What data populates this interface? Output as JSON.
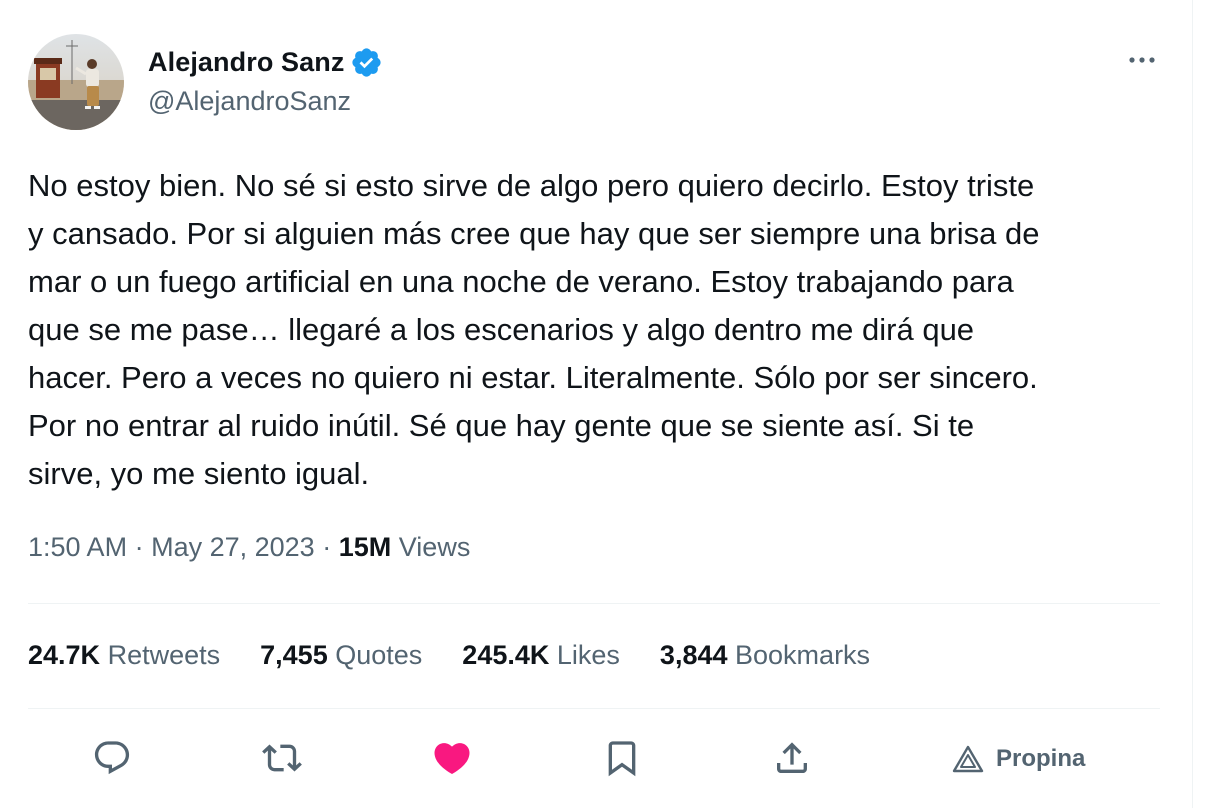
{
  "author": {
    "display_name": "Alejandro Sanz",
    "handle": "@AlejandroSanz",
    "verified": true
  },
  "tweet": {
    "text_lines": [
      "No estoy bien. No sé si esto sirve de algo pero quiero decirlo. Estoy triste",
      "y cansado. Por si alguien más cree que hay que ser siempre una brisa de",
      "mar o un fuego artificial en una noche de verano. Estoy trabajando para",
      "que se me pase… llegaré a los escenarios y algo dentro me dirá que",
      "hacer. Pero a veces no quiero ni estar. Literalmente. Sólo por ser sincero.",
      "Por no entrar al ruido inútil. Sé que hay gente que se siente así. Si te",
      "sirve, yo me siento igual."
    ]
  },
  "meta": {
    "time": "1:50 AM",
    "separator": "·",
    "date": "May 27, 2023",
    "views_count": "15M",
    "views_label": "Views"
  },
  "stats": [
    {
      "count": "24.7K",
      "label": "Retweets"
    },
    {
      "count": "7,455",
      "label": "Quotes"
    },
    {
      "count": "245.4K",
      "label": "Likes"
    },
    {
      "count": "3,844",
      "label": "Bookmarks"
    }
  ],
  "actions": {
    "reply_icon": "reply-icon",
    "retweet_icon": "retweet-icon",
    "like_icon": "heart-icon",
    "bookmark_icon": "bookmark-icon",
    "share_icon": "share-icon",
    "tip_label": "Propina",
    "tip_icon": "tip-icon"
  },
  "colors": {
    "text_primary": "#0f1419",
    "text_secondary": "#536471",
    "verified_blue": "#1d9bf0",
    "like_pink": "#f91880",
    "divider": "#eff3f4"
  }
}
